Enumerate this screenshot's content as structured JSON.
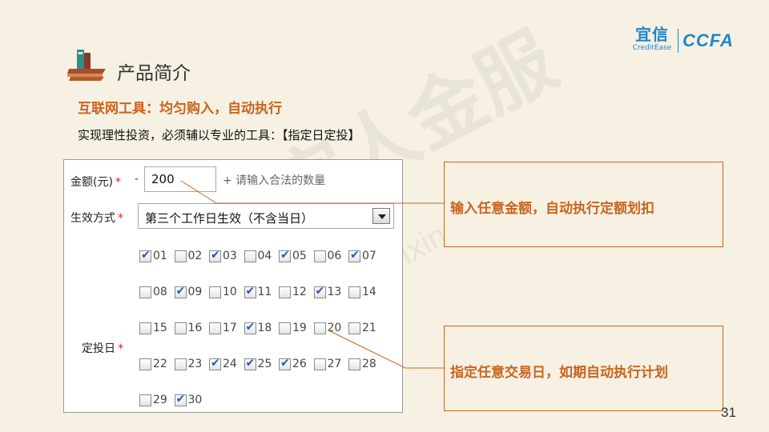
{
  "logo": {
    "brand_cn": "宜信",
    "brand_en": "CreditEase",
    "partner": "CCFA"
  },
  "title": "产品简介",
  "subtitle": "互联网工具：均匀购入，自动执行",
  "description": "实现理性投资，必须辅以专业的工具：【指定日定投】",
  "watermark": {
    "cn": "宜人金服",
    "en": "xinhuo.yixin.com"
  },
  "form": {
    "amount_label": "金额(元)",
    "required_mark": "*",
    "dash": "-",
    "amount_value": "200",
    "amount_hint": "+ 请输入合法的数量",
    "effect_label": "生效方式",
    "effect_selected": "第三个工作日生效（不含当日）",
    "days_label": "定投日",
    "days": [
      {
        "label": "01",
        "checked": true
      },
      {
        "label": "02",
        "checked": false
      },
      {
        "label": "03",
        "checked": true
      },
      {
        "label": "04",
        "checked": false
      },
      {
        "label": "05",
        "checked": true
      },
      {
        "label": "06",
        "checked": false
      },
      {
        "label": "07",
        "checked": true
      },
      {
        "label": "08",
        "checked": false
      },
      {
        "label": "09",
        "checked": true
      },
      {
        "label": "10",
        "checked": false
      },
      {
        "label": "11",
        "checked": true
      },
      {
        "label": "12",
        "checked": false
      },
      {
        "label": "13",
        "checked": true
      },
      {
        "label": "14",
        "checked": false
      },
      {
        "label": "15",
        "checked": false
      },
      {
        "label": "16",
        "checked": false
      },
      {
        "label": "17",
        "checked": false
      },
      {
        "label": "18",
        "checked": true
      },
      {
        "label": "19",
        "checked": false
      },
      {
        "label": "20",
        "checked": false
      },
      {
        "label": "21",
        "checked": false
      },
      {
        "label": "22",
        "checked": false
      },
      {
        "label": "23",
        "checked": false
      },
      {
        "label": "24",
        "checked": true
      },
      {
        "label": "25",
        "checked": true
      },
      {
        "label": "26",
        "checked": true
      },
      {
        "label": "27",
        "checked": false
      },
      {
        "label": "28",
        "checked": false
      },
      {
        "label": "29",
        "checked": false
      },
      {
        "label": "30",
        "checked": true
      }
    ]
  },
  "callouts": {
    "amount_note": "输入任意金额，自动执行定额划扣",
    "days_note": "指定任意交易日，如期自动执行计划"
  },
  "colors": {
    "accent": "#c8641e",
    "brand": "#1f86c8",
    "check": "#2855b8",
    "background": "#f6f1e3"
  },
  "page_number": "31"
}
